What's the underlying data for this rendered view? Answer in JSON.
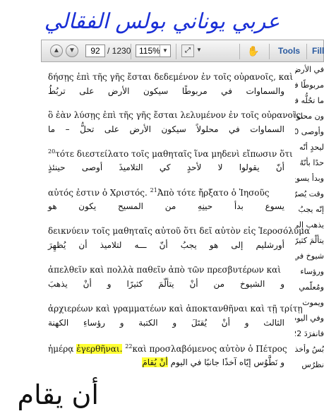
{
  "handwriting": {
    "top": "عربي يوناني بولس الفقالي",
    "bottom": "أن يقام"
  },
  "toolbar": {
    "prev_icon": "arrow-up-icon",
    "next_icon": "arrow-down-icon",
    "page_current": "92",
    "page_total": "/ 1230",
    "zoom": "115%",
    "tools": "Tools",
    "fill": "Fill"
  },
  "verses": [
    {
      "greek": "δήσῃς ἐπὶ τῆς γῆς ἔσται δεδεμένον ἐν τοῖς οὐρανοῖς, καὶ",
      "arabic": "والسماوات في مربوطًا سيكون الأرض على تربُطُ"
    },
    {
      "greek": "ὃ ἐὰν λύσῃς ἐπὶ τῆς γῆς ἔσται λελυμένον ἐν τοῖς οὐρανοῖς.",
      "arabic": "السماوات في محلولاً سيكون الأرض على تحلُّ – ما"
    },
    {
      "greek": "τότε διεστείλατο τοῖς μαθηταῖς ἵνα μηδενὶ εἴπωσιν ὅτι",
      "greek_sup": "20",
      "arabic": "أنّ يقولوا لا لأحدٍ كي التلاميذَ أوصى حينئذٍ"
    },
    {
      "greek": "αὐτός ἐστιν ὁ Χριστός.",
      "greek_sup": "21",
      "greek_rest": "Ἀπὸ τότε ἤρξατο ὁ Ἰησοῦς",
      "arabic": "يسوع بدأ حينِهِ من المسيح يكون هو"
    },
    {
      "greek": "δεικνύειν τοῖς μαθηταῖς αὐτοῦ ὅτι δεῖ αὐτὸν εἰς Ἱεροσόλυμα",
      "arabic": "أورشليم إلى هو يجبُ أنّ ـــه لتلاميذ أن يُظهِرَ"
    },
    {
      "greek": "ἀπελθεῖν καὶ πολλὰ παθεῖν ἀπὸ τῶν πρεσβυτέρων καὶ",
      "arabic": "و الشيوخ من أنْ يتألّمَ كثيرًا و أنْ يذهبَ"
    },
    {
      "greek": "ἀρχιερέων καὶ γραμματέων καὶ ἀποκτανθῆναι καὶ τῇ τρίτῃ",
      "arabic": "الثالث و أنْ يُقتَلَ و الكتبة و رؤساءِ الكهنة"
    },
    {
      "greek_hl_pre": "ἡμέρᾳ",
      "greek_hl": "ἐγερθῆναι.",
      "greek_sup": "22",
      "greek_rest": "καὶ προσλαβόμενος αὐτὸν ὁ Πέτρος",
      "arabic_hl": "أنْ يُقامَ",
      "arabic": "و نَطَّوُس إيّاه آخذًا جانبًا في اليوم"
    }
  ],
  "right_column": [
    "في الأرض",
    "مربوطًا في",
    "ما تحُلُّه في",
    "ون محلولاً",
    "وأوصى 20",
    "ليحدٍ أنّه",
    "حدًا بأنّهُ",
    "وبدأ يسوعُ",
    "وقت يُصرّحُ",
    "إنّه يجبُ",
    "يذهب إلى",
    "يتألّمَ كثيرًا",
    "شيوخ في",
    "ورؤساء",
    "ومُعلّمي",
    "ويموت",
    "وفي اليوم",
    "فانفرَدَ 22",
    "بُسُ وأخذ",
    "نظرُس"
  ]
}
